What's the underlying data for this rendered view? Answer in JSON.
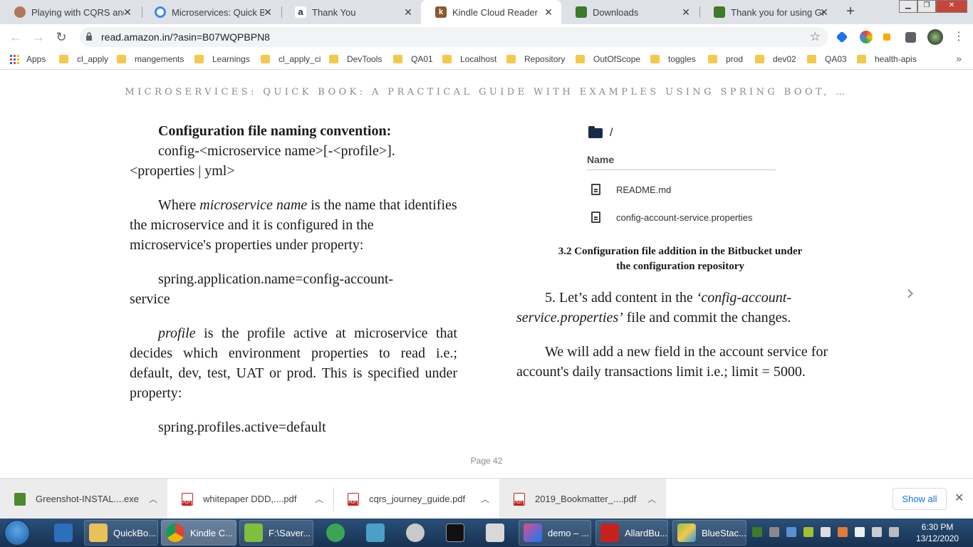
{
  "browser": {
    "tabs": [
      {
        "title": "Playing with CQRS and E",
        "favicon": "avatar-favicon",
        "color": "#b0785a"
      },
      {
        "title": "Microservices: Quick Boo",
        "favicon": "google-favicon",
        "color": "#4285f4"
      },
      {
        "title": "Thank You",
        "favicon": "amazon-favicon",
        "color": "#232f3e"
      },
      {
        "title": "Kindle Cloud Reader",
        "favicon": "kindle-favicon",
        "color": "#8a5a2b"
      },
      {
        "title": "Downloads",
        "favicon": "greenshot-favicon",
        "color": "#3d7a2a"
      },
      {
        "title": "Thank you for using Gree",
        "favicon": "greenshot-favicon",
        "color": "#3d7a2a"
      }
    ],
    "active_tab": 3,
    "url": "read.amazon.in/?asin=B07WQPBPN8",
    "bookmarks": [
      "Apps",
      "cl_apply",
      "mangements",
      "Learnings",
      "cl_apply_ci",
      "DevTools",
      "QA01",
      "Localhost",
      "Repository",
      "OutOfScope",
      "toggles",
      "prod",
      "dev02",
      "QA03",
      "health-apis"
    ]
  },
  "book": {
    "title": "MICROSERVICES: QUICK BOOK: A PRACTICAL GUIDE WITH EXAMPLES USING SPRING BOOT, …",
    "left": {
      "heading": "Configuration file naming convention:",
      "convention_line1": "config-<microservice name>[-<profile>].",
      "convention_line2": "<properties | yml>",
      "p1_pre": "Where ",
      "p1_em": "microservice name",
      "p1_post": " is the name that identifies the microservice and it is configured in the microservice's properties under property:",
      "code1_line1": "spring.application.name=config-account-",
      "code1_line2": "service",
      "p2_em": "profile",
      "p2_post": " is the profile active at microservice that decides which environment properties to read i.e.; default, dev, test, UAT or prod. This is specified under property:",
      "code2": "spring.profiles.active=default"
    },
    "repo": {
      "path": "/",
      "column": "Name",
      "files": [
        "README.md",
        "config-account-service.properties"
      ]
    },
    "caption_line1": "3.2 Configuration file addition in the Bitbucket under",
    "caption_line2": "the configuration repository",
    "right": {
      "p1_pre": "5. Let’s add content in the ",
      "p1_em": "‘config-account-service.properties’",
      "p1_post": " file and commit the changes.",
      "p2": "We will add a new field in the account service for account's daily transactions limit i.e.; limit = 5000."
    },
    "page": "Page 42"
  },
  "downloads": {
    "items": [
      "Greenshot-INSTAL....exe",
      "whitepaper DDD,....pdf",
      "cqrs_journey_guide.pdf",
      "2019_Bookmatter_....pdf"
    ],
    "show_all": "Show all"
  },
  "taskbar": {
    "items": [
      {
        "label": "",
        "icon": "chrome-alt-icon",
        "color": "#2c6fbd"
      },
      {
        "label": "QuickBo...",
        "icon": "folder-icon",
        "color": "#e8c15a"
      },
      {
        "label": "Kindle C...",
        "icon": "chrome-icon",
        "color": "#db4437"
      },
      {
        "label": "F:\\Saver...",
        "icon": "notepad-icon",
        "color": "#7fbf3f"
      },
      {
        "label": "",
        "icon": "clock-app-icon",
        "color": "#3aa655"
      },
      {
        "label": "",
        "icon": "editor-icon",
        "color": "#4aa0c8"
      },
      {
        "label": "",
        "icon": "snipping-icon",
        "color": "#c9c9c9"
      },
      {
        "label": "",
        "icon": "cmd-icon",
        "color": "#111111"
      },
      {
        "label": "",
        "icon": "calc-icon",
        "color": "#d8d8d8"
      },
      {
        "label": "demo – ...",
        "icon": "intellij-icon",
        "color": "#e64a8a"
      },
      {
        "label": "AllardBu...",
        "icon": "acrobat-icon",
        "color": "#c5221f"
      },
      {
        "label": "BlueStac...",
        "icon": "bluestacks-icon",
        "color": "#8bc34a"
      }
    ],
    "time": "6:30 PM",
    "date": "13/12/2020"
  }
}
